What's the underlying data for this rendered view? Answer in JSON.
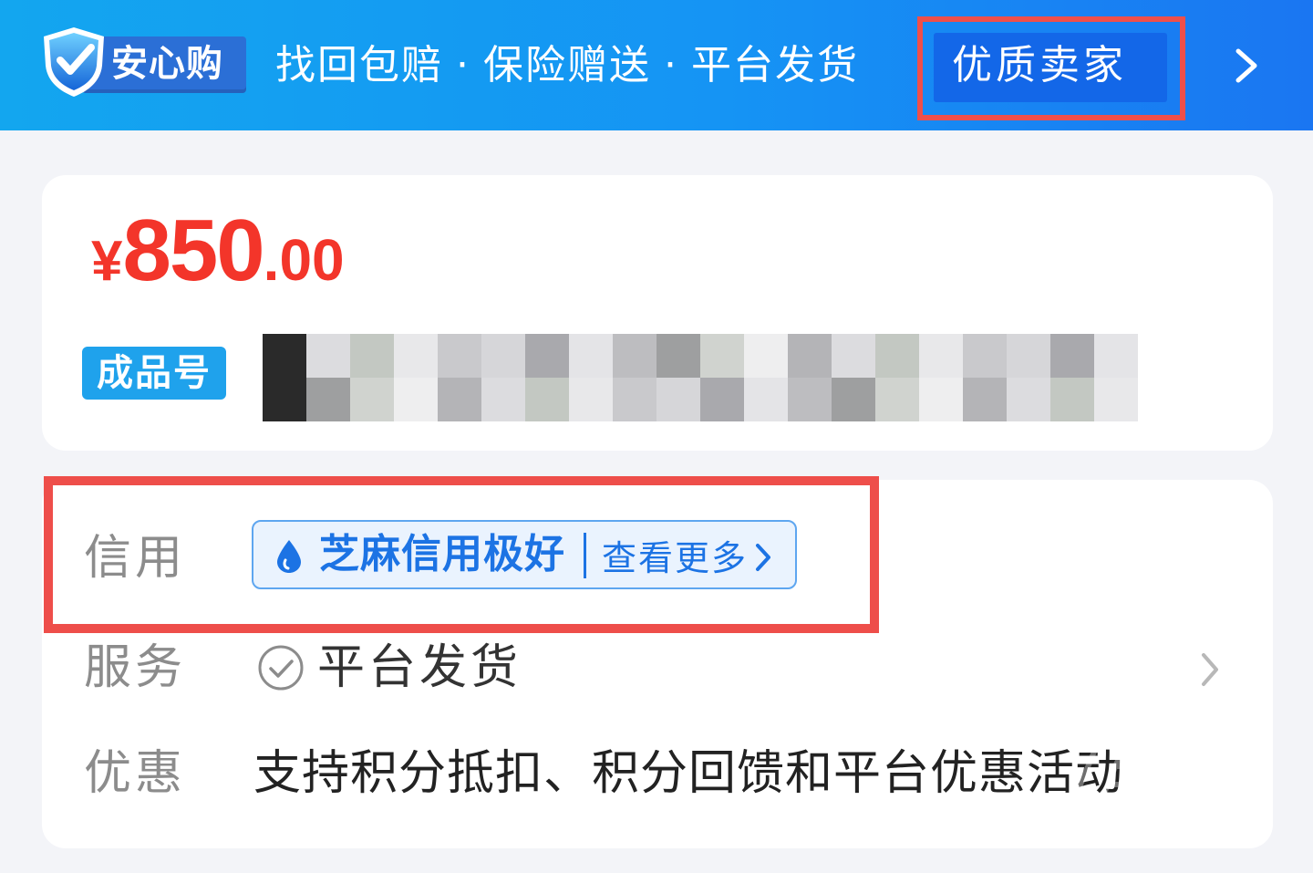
{
  "banner": {
    "badge_label": "安心购",
    "features": [
      "找回包赔",
      "保险赠送",
      "平台发货"
    ],
    "separator": "·",
    "seller_label": "优质卖家",
    "chevron_icon": "chevron-right-icon"
  },
  "product": {
    "currency": "¥",
    "price_integer": "850",
    "price_decimal": ".00",
    "tag": "成品号",
    "title_obscured": true
  },
  "details": {
    "credit_label": "信用",
    "credit_badge": "芝麻信用极好",
    "credit_more": "查看更多",
    "service_label": "服务",
    "service_value": "平台发货",
    "promo_label": "优惠",
    "promo_value": "支持积分抵扣、积分回馈和平台优惠活动"
  },
  "colors": {
    "banner_start": "#13a6ef",
    "banner_end": "#1a76f2",
    "price_red": "#f3352a",
    "highlight_red": "#ee4e4a",
    "sesame_blue": "#1c73e4",
    "tag_blue": "#1fa2ec"
  }
}
